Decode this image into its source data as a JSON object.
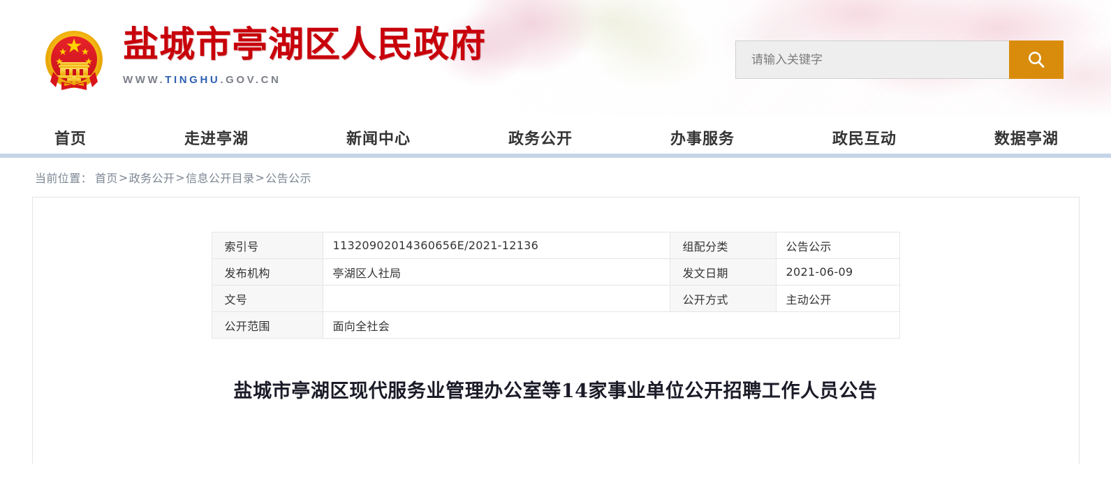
{
  "header": {
    "site_title": "盐城市亭湖区人民政府",
    "site_url_prefix": "WWW.",
    "site_url_highlight": "TINGHU",
    "site_url_suffix": ".GOV.CN",
    "emblem_alt": "中华人民共和国国徽"
  },
  "search": {
    "placeholder": "请输入关键字",
    "value": "",
    "button_icon": "search-icon",
    "button_color": "#d98c0c"
  },
  "nav": {
    "items": [
      {
        "label": "首页"
      },
      {
        "label": "走进亭湖"
      },
      {
        "label": "新闻中心"
      },
      {
        "label": "政务公开"
      },
      {
        "label": "办事服务"
      },
      {
        "label": "政民互动"
      },
      {
        "label": "数据亭湖"
      }
    ]
  },
  "breadcrumb": {
    "label": "当前位置：",
    "separator": ">",
    "items": [
      {
        "label": "首页"
      },
      {
        "label": "政务公开"
      },
      {
        "label": "信息公开目录"
      },
      {
        "label": "公告公示"
      }
    ]
  },
  "meta_table": {
    "rows": [
      {
        "left_key": "索引号",
        "left_value": "11320902014360656E/2021-12136",
        "right_key": "组配分类",
        "right_value": "公告公示"
      },
      {
        "left_key": "发布机构",
        "left_value": "亭湖区人社局",
        "right_key": "发文日期",
        "right_value": "2021-06-09"
      },
      {
        "left_key": "文号",
        "left_value": "",
        "right_key": "公开方式",
        "right_value": "主动公开"
      }
    ],
    "full_row": {
      "key": "公开范围",
      "value": "面向全社会"
    }
  },
  "article": {
    "title": "盐城市亭湖区现代服务业管理办公室等14家事业单位公开招聘工作人员公告"
  },
  "colors": {
    "brand_red": "#c8000a",
    "accent_orange": "#d98c0c",
    "nav_rule": "#c5d5e8",
    "link_blue": "#2f5fb0"
  }
}
